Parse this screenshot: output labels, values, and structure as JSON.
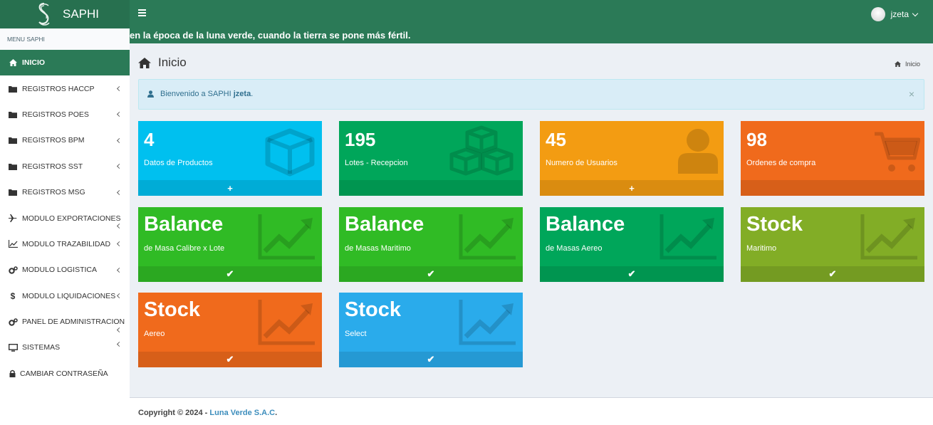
{
  "header": {
    "app_name": "SAPHI",
    "user_name": "jzeta",
    "marquee": "en la época de la luna verde, cuando la tierra se pone más fértil."
  },
  "sidebar": {
    "menu_header": "MENU SAPHI",
    "items": [
      {
        "label": "INICIO",
        "icon": "home-icon"
      },
      {
        "label": "REGISTROS HACCP",
        "icon": "folder-icon"
      },
      {
        "label": "REGISTROS POES",
        "icon": "folder-icon"
      },
      {
        "label": "REGISTROS BPM",
        "icon": "folder-icon"
      },
      {
        "label": "REGISTROS SST",
        "icon": "folder-icon"
      },
      {
        "label": "REGISTROS MSG",
        "icon": "folder-icon"
      },
      {
        "label": "MODULO EXPORTACIONES",
        "icon": "plane-icon"
      },
      {
        "label": "MODULO TRAZABILIDAD",
        "icon": "line-chart-icon"
      },
      {
        "label": "MODULO LOGISTICA",
        "icon": "gears-icon"
      },
      {
        "label": "MODULO LIQUIDACIONES",
        "icon": "dollar-icon"
      },
      {
        "label": "PANEL DE ADMINISTRACION",
        "icon": "gears-icon"
      },
      {
        "label": "SISTEMAS",
        "icon": "monitor-icon"
      },
      {
        "label": "CAMBIAR CONTRASEÑA",
        "icon": "lock-icon"
      }
    ]
  },
  "content": {
    "page_title": "Inicio",
    "breadcrumb": "Inicio",
    "alert": {
      "text": "Bienvenido a SAPHI ",
      "user": "jzeta",
      "suffix": ".",
      "close": "×"
    }
  },
  "boxes": [
    {
      "value": "4",
      "label": "Datos de Productos",
      "footer": "+",
      "color": "#00c0ef",
      "icon": "cube-icon"
    },
    {
      "value": "195",
      "label": "Lotes - Recepcion",
      "footer": "",
      "color": "#00a65a",
      "icon": "cubes-icon"
    },
    {
      "value": "45",
      "label": "Numero de Usuarios",
      "footer": "+",
      "color": "#f39c12",
      "icon": "user-icon"
    },
    {
      "value": "98",
      "label": "Ordenes de compra",
      "footer": "",
      "color": "#f06a1c",
      "icon": "cart-icon"
    },
    {
      "value": "Balance",
      "label": "de Masa Calibre x Lote",
      "footer": "✔",
      "color": "#30bb25",
      "icon": "area-chart-icon"
    },
    {
      "value": "Balance",
      "label": "de Masas Maritimo",
      "footer": "✔",
      "color": "#30bb25",
      "icon": "area-chart-icon"
    },
    {
      "value": "Balance",
      "label": "de Masas Aereo",
      "footer": "✔",
      "color": "#00a65a",
      "icon": "area-chart-icon"
    },
    {
      "value": "Stock",
      "label": "Maritimo",
      "footer": "✔",
      "color": "#82ad26",
      "icon": "area-chart-icon"
    },
    {
      "value": "Stock",
      "label": "Aereo",
      "footer": "✔",
      "color": "#f06a1c",
      "icon": "area-chart-icon"
    },
    {
      "value": "Stock",
      "label": "Select",
      "footer": "✔",
      "color": "#2aabeb",
      "icon": "area-chart-icon"
    }
  ],
  "footer": {
    "copyright": "Copyright © 2024 - ",
    "company": "Luna Verde S.A.C",
    "end": "."
  }
}
